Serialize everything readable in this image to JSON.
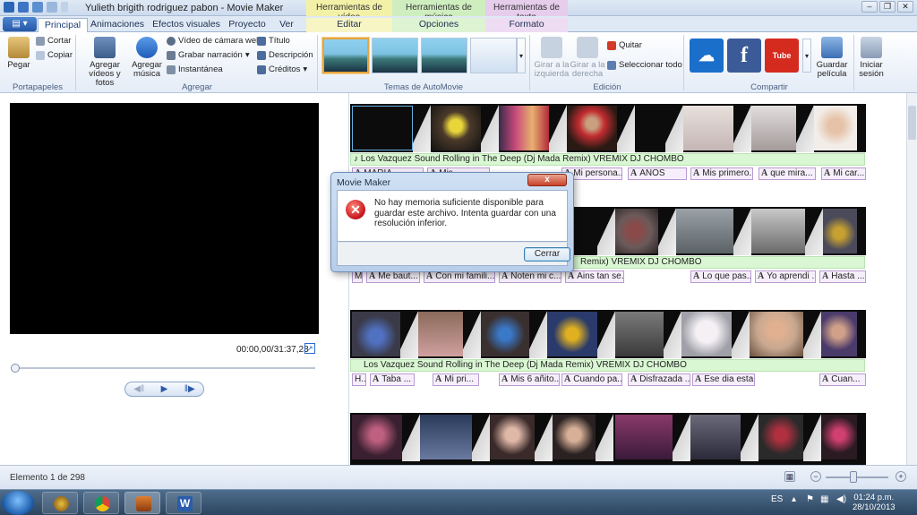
{
  "window": {
    "title": "Yulieth brigith rodriguez pabon - Movie Maker",
    "context_groups": [
      "Herramientas de vídeo",
      "Herramientas de música",
      "Herramientas de texto"
    ],
    "controls": [
      "–",
      "❐",
      "✕"
    ]
  },
  "tabs": [
    "Principal",
    "Animaciones",
    "Efectos visuales",
    "Proyecto",
    "Ver",
    "Editar",
    "Opciones",
    "Formato"
  ],
  "ribbon": {
    "portapapeles": {
      "label": "Portapapeles",
      "pegar": "Pegar",
      "cortar": "Cortar",
      "copiar": "Copiar"
    },
    "agregar": {
      "label": "Agregar",
      "videos": "Agregar vídeos y fotos",
      "musica": "Agregar música",
      "webcam": "Vídeo de cámara web",
      "narracion": "Grabar narración",
      "instantanea": "Instantánea",
      "titulo": "Título",
      "descripcion": "Descripción",
      "creditos": "Créditos"
    },
    "temas": {
      "label": "Temas de AutoMovie"
    },
    "editar": {
      "label": "Edición",
      "girar_izq": "Girar a la izquierda",
      "girar_der": "Girar a la derecha",
      "quitar": "Quitar",
      "seleccionar": "Seleccionar todo"
    },
    "compartir": {
      "label": "Compartir",
      "guardar": "Guardar película",
      "iniciar": "Iniciar sesión"
    }
  },
  "preview": {
    "timecode": "00:00,00/31:37,23"
  },
  "storyboard": {
    "audio": {
      "row1": "♪ Los Vazquez Sound   Rolling in The Deep (Dj Mada Remix) VREMIX   DJ CHOMBO",
      "row2": "Remix) VREMIX   DJ CHOMBO",
      "row3": "Los Vazquez Sound   Rolling in The Deep (Dj Mada Remix) VREMIX   DJ CHOMBO"
    },
    "captions_row1": [
      "MARIA...",
      "Mis...",
      "Mi persona...",
      "AÑOS",
      "Mis primero...",
      "que mira...",
      "Mi car..."
    ],
    "captions_row2": [
      "M",
      "Me baut...",
      "Con mi famili...",
      "Noten mi c...",
      "Ains tan se...",
      "Lo que pas...",
      "Yo aprendi ...",
      "Hasta ..."
    ],
    "captions_row3": [
      "H...",
      "Taba ...",
      "Mi pri...",
      "Mis 6 añito...",
      "Cuando pa...",
      "Disfrazada ...",
      "Ese dia esta...",
      "Cuan..."
    ]
  },
  "status": {
    "item": "Elemento 1 de 298"
  },
  "dialog": {
    "title": "Movie Maker",
    "message": "No hay memoria suficiente disponible para guardar este archivo. Intenta guardar con una resolución inferior.",
    "button": "Cerrar",
    "close": "x"
  },
  "taskbar": {
    "lang": "ES",
    "time": "01:24 p.m.",
    "date": "28/10/2013"
  },
  "colors": {
    "accent": "#2758a8",
    "audio_bar": "#d9f7d2",
    "caption_bar": "#f6effb",
    "error": "#c5121a"
  }
}
